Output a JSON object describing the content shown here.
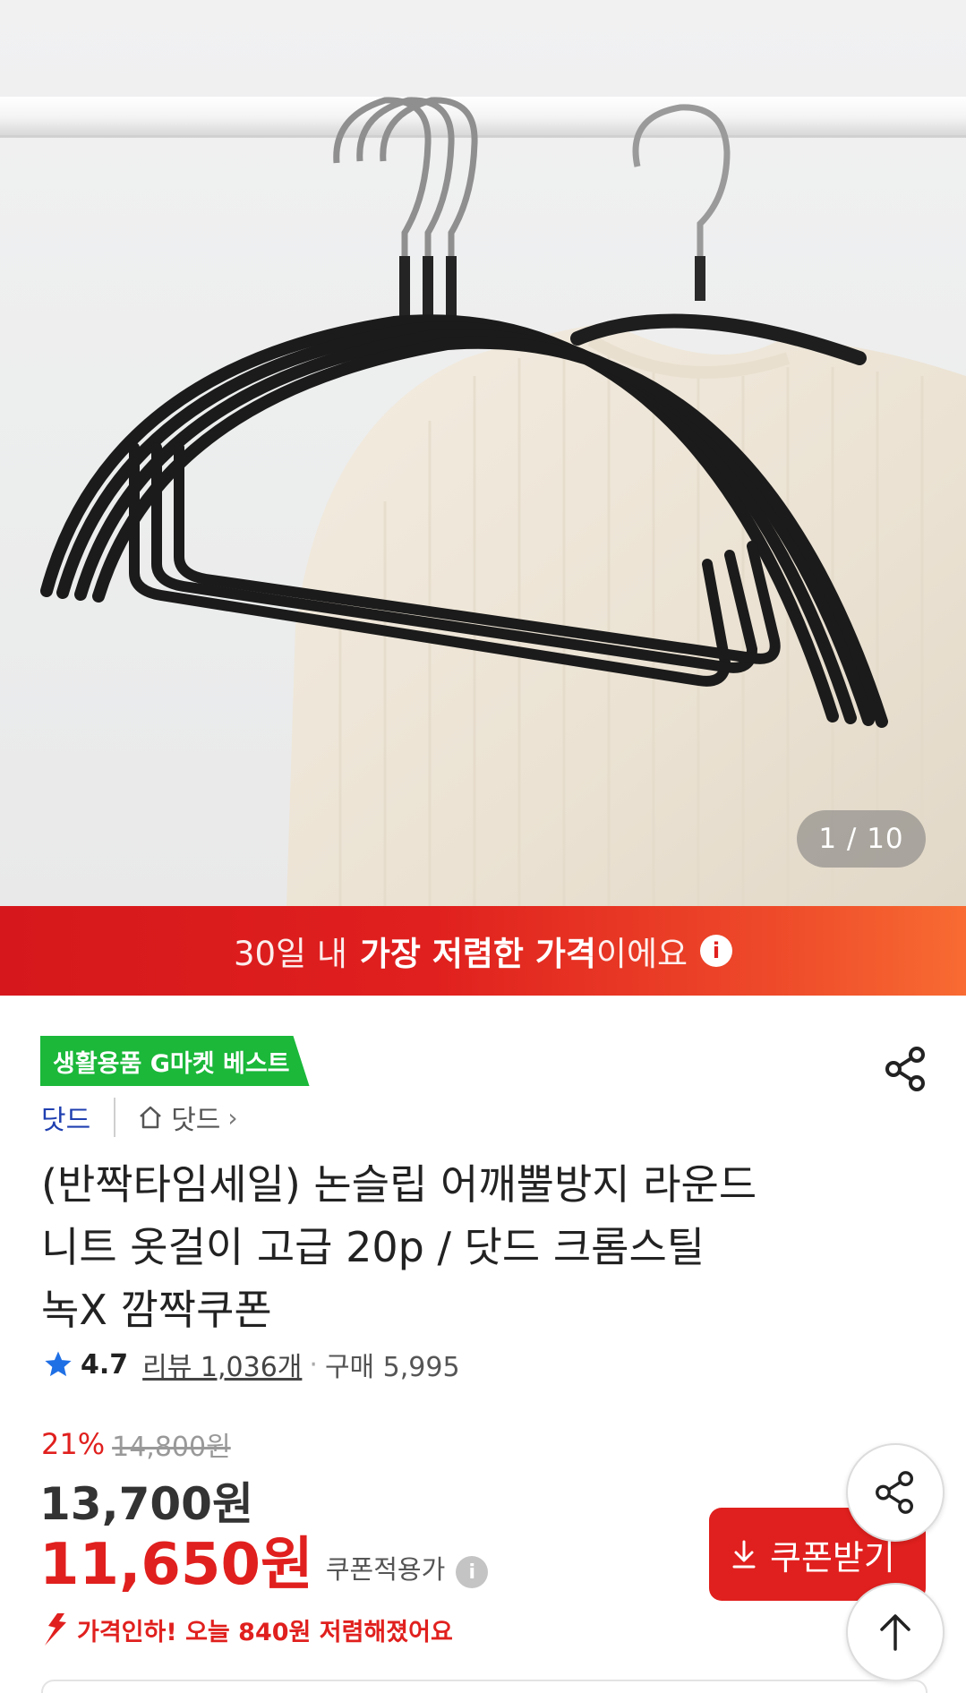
{
  "gallery": {
    "counter": "1 / 10"
  },
  "banner": {
    "prefix": "30일 내 ",
    "highlight": "가장 저렴한 가격",
    "suffix": "이에요"
  },
  "product": {
    "badge": "생활용품 G마켓 베스트",
    "brand": "닷드",
    "shop": "닷드",
    "title_lines": [
      "(반짝타임세일) 논슬립 어깨뿔방지 라운드",
      "니트 옷걸이 고급 20p / 닷드 크롬스틸",
      "녹X 깜짝쿠폰"
    ],
    "rating": "4.7",
    "reviews": "리뷰 1,036개",
    "purchases": "구매 5,995"
  },
  "pricing": {
    "discount_rate": "21%",
    "original_price": "14,800원",
    "price": "13,700원",
    "coupon_price": "11,650원",
    "coupon_label": "쿠폰적용가",
    "price_down_note": "가격인하! 오늘 840원 저렴해졌어요",
    "coupon_button": "쿠폰받기"
  },
  "colors": {
    "accent_red": "#e0201e",
    "badge_green": "#1bb83a",
    "brand_blue": "#1f3fb0",
    "star_blue": "#1f6fe5"
  }
}
